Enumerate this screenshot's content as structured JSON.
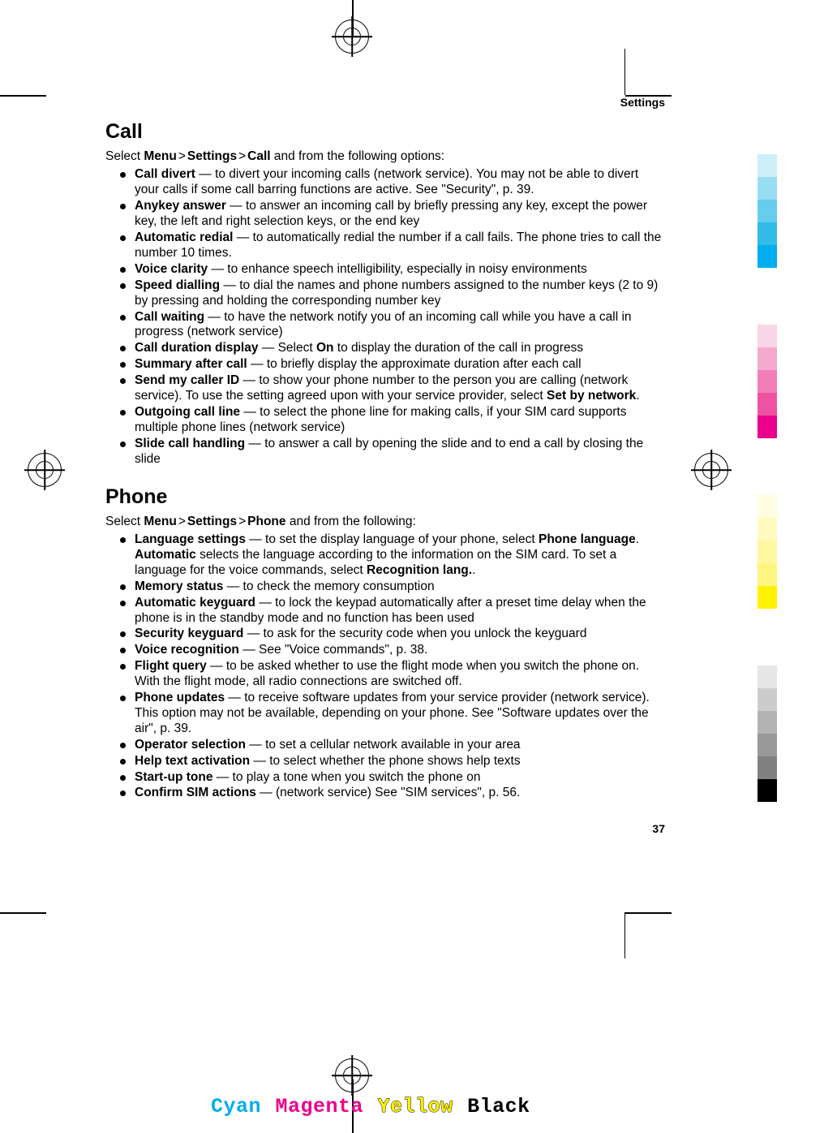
{
  "running_head": "Settings",
  "page_number": "37",
  "nav": {
    "menu": "Menu",
    "settings": "Settings",
    "sep": ">"
  },
  "sections": {
    "call": {
      "title": "Call",
      "lead_pre": "Select ",
      "lead_crumb3": "Call",
      "lead_post": " and from the following options:",
      "items": [
        {
          "term": "Call divert",
          "rest": "  — to divert your incoming calls (network service). You may not be able to divert your calls if some call barring functions are active. See \"Security\", p. 39."
        },
        {
          "term": "Anykey answer",
          "rest": "  — to answer an incoming call by briefly pressing any key, except the power key, the left and right selection keys, or the end key"
        },
        {
          "term": "Automatic redial",
          "rest": "  — to automatically redial the number if a call fails. The phone tries to call the number 10 times."
        },
        {
          "term": "Voice clarity",
          "rest": "  — to enhance speech intelligibility, especially in noisy environments"
        },
        {
          "term": "Speed dialling",
          "rest": "  — to dial the names and phone numbers assigned to the number keys (2 to 9) by pressing and holding the corresponding number key"
        },
        {
          "term": "Call waiting",
          "rest": "  — to have the network notify you of an incoming call while you have a call in progress (network service)"
        },
        {
          "term": "Call duration display",
          "rest_pre": "  — Select ",
          "bold_mid": "On",
          "rest_post": " to display the duration of the call in progress"
        },
        {
          "term": "Summary after call",
          "rest": "  — to briefly display the approximate duration after each call"
        },
        {
          "term": "Send my caller ID",
          "rest_pre": "  — to show your phone number to the person you are calling (network service). To use the setting agreed upon with your service provider, select ",
          "bold_mid": "Set by network",
          "rest_post": "."
        },
        {
          "term": "Outgoing call line",
          "rest": "  — to select the phone line for making calls, if your SIM card supports multiple phone lines (network service)"
        },
        {
          "term": "Slide call handling",
          "rest": "  — to answer a call by opening the slide and to end a call by closing the slide"
        }
      ]
    },
    "phone": {
      "title": "Phone",
      "lead_pre": "Select ",
      "lead_crumb3": "Phone",
      "lead_post": " and from the following:",
      "items": [
        {
          "term": "Language settings",
          "rest_pre": "  — to set the display language of your phone, select ",
          "bold_mid": "Phone language",
          "rest_mid": ". ",
          "bold_mid2": "Automatic",
          "rest_mid2": " selects the language according to the information on the SIM card. To set a language for the voice commands, select ",
          "bold_mid3": "Recognition lang.",
          "rest_post": "."
        },
        {
          "term": "Memory status",
          "rest": "  — to check the memory consumption"
        },
        {
          "term": "Automatic keyguard",
          "rest": "  — to lock the keypad automatically after a preset time delay when the phone is in the standby mode and no function has been used"
        },
        {
          "term": "Security keyguard",
          "rest": "  — to ask for the security code when you unlock the keyguard"
        },
        {
          "term": "Voice recognition",
          "rest": "  —  See \"Voice commands\", p. 38."
        },
        {
          "term": "Flight query",
          "rest": "  — to be asked whether to use the flight mode when you switch the phone on. With the flight mode, all radio connections are switched off."
        },
        {
          "term": "Phone updates",
          "rest": "  — to receive software updates from your service provider (network service). This option may not be available, depending on your phone. See \"Software updates over the air\", p. 39."
        },
        {
          "term": "Operator selection",
          "rest": "  — to set a cellular network available in your area"
        },
        {
          "term": "Help text activation",
          "rest": "  — to select whether the phone shows help texts"
        },
        {
          "term": "Start-up tone",
          "rest": "  — to play a tone when you switch the phone on"
        },
        {
          "term": "Confirm SIM actions",
          "rest": "  — (network service) See \"SIM services\", p. 56."
        }
      ]
    }
  },
  "process": {
    "c": "Cyan",
    "m": "Magenta",
    "y": "Yellow",
    "k": "Black"
  },
  "swatches": {
    "cyan": [
      "#cceef9",
      "#99ddf3",
      "#66cdee",
      "#33bbe7",
      "#00adee"
    ],
    "magenta": [
      "#fad4e7",
      "#f5a9cf",
      "#f17eb8",
      "#ed53a1",
      "#ec008c"
    ],
    "yellow": [
      "#fffde0",
      "#fffac0",
      "#fff8a0",
      "#fff580",
      "#fff200"
    ],
    "gray": [
      "#e6e6e6",
      "#cccccc",
      "#b3b3b3",
      "#999999",
      "#808080",
      "#000000"
    ]
  }
}
